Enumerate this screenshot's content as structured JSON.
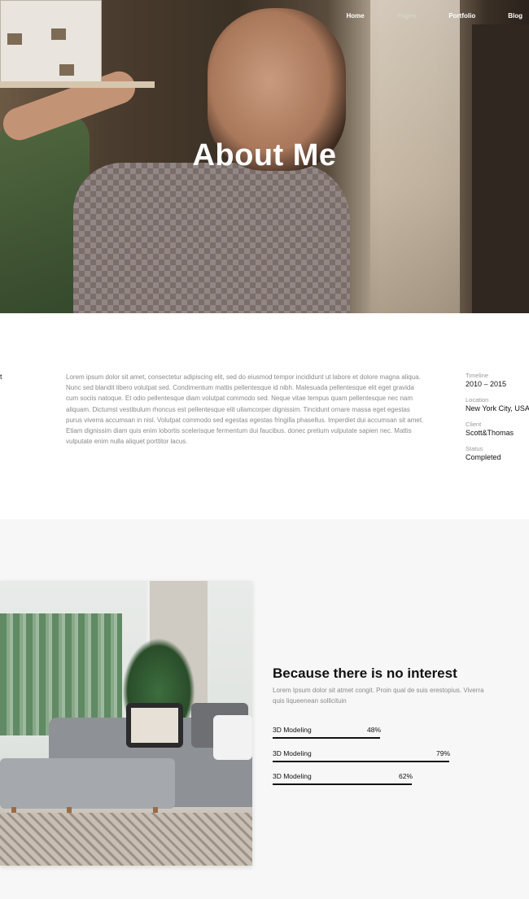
{
  "nav": {
    "items": [
      {
        "label": "Home"
      },
      {
        "label": "Pages"
      },
      {
        "label": "Portfolio"
      },
      {
        "label": "Blog"
      }
    ]
  },
  "hero": {
    "title": "About Me"
  },
  "info": {
    "cut_label": "t",
    "description": "Lorem ipsum dolor sit amet, consectetur adipiscing elit, sed do eiusmod tempor incididunt ut labore et dolore magna aliqua. Nunc sed blandit libero volutpat sed. Condimentum mattis pellentesque id nibh. Malesuada pellentesque elit eget gravida cum sociis natoque. Et odio pellentesque diam volutpat commodo sed. Neque vitae tempus quam pellentesque nec nam aliquam. Dictumst vestibulum rhoncus est pellentesque elit ullamcorper dignissim. Tincidunt ornare massa eget egestas purus viverra accumsan in nisl. Volutpat commodo sed egestas egestas fringilla phasellus. Imperdiet dui accumsan sit amet. Etiam dignissim diam quis enim lobortis scelerisque fermentum dui faucibus. donec pretium vulputate sapien nec. Mattis vulputate enim nulla aliquet porttitor lacus.",
    "meta": [
      {
        "label": "Timeline",
        "value": "2010 – 2015"
      },
      {
        "label": "Location",
        "value": "New York City, USA"
      },
      {
        "label": "Client",
        "value": "Scott&Thomas"
      },
      {
        "label": "Status",
        "value": "Completed"
      }
    ]
  },
  "about": {
    "title": "Because there is no interest",
    "text": "Lorem Ipsum dolor sit atmet congit. Proin qual de suis erestopius. Viverra quis  liqueenean sollicituin"
  },
  "skills": [
    {
      "label": "3D Modeling",
      "percent": 48
    },
    {
      "label": "3D Modeling",
      "percent": 79
    },
    {
      "label": "3D Modeling",
      "percent": 62
    }
  ],
  "colors": {
    "accent": "#111111",
    "muted_text": "#8a8a8a",
    "section_bg": "#f7f7f7"
  }
}
